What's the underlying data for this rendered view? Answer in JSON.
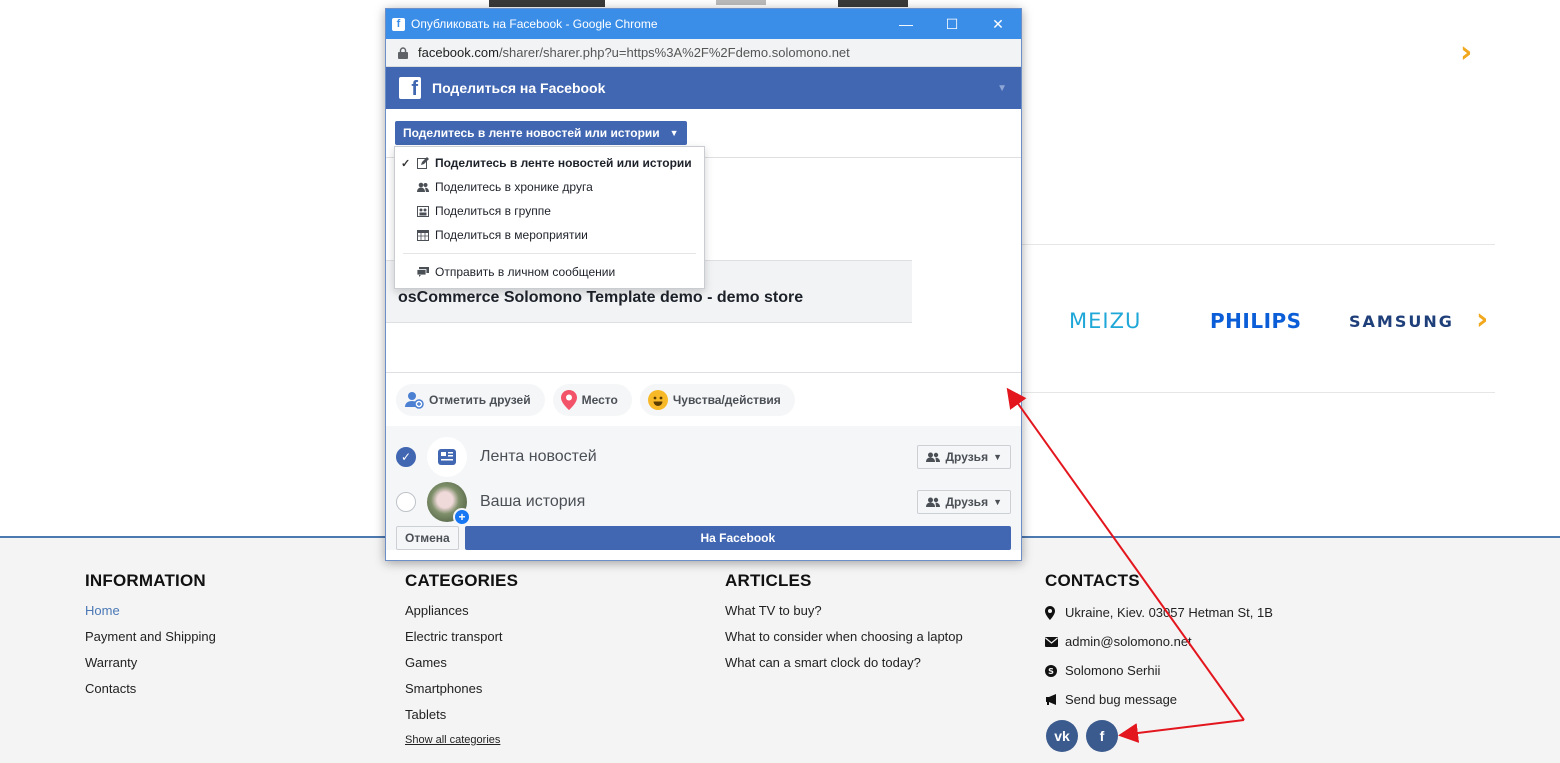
{
  "window": {
    "title": "Опубликовать на Facebook - Google Chrome",
    "controls": [
      "—",
      "☐",
      "✕"
    ],
    "url_host": "facebook.com",
    "url_path": "/sharer/sharer.php?u=https%3A%2F%2Fdemo.solomono.net"
  },
  "fb": {
    "header": "Поделиться на Facebook",
    "share_button": "Поделитесь в ленте новостей или истории",
    "menu": {
      "items": [
        {
          "label": "Поделитесь в ленте новостей или истории",
          "icon": "edit-icon",
          "selected": true
        },
        {
          "label": "Поделитесь в хронике друга",
          "icon": "friends-icon"
        },
        {
          "label": "Поделиться в группе",
          "icon": "group-icon"
        },
        {
          "label": "Поделиться в мероприятии",
          "icon": "calendar-icon"
        }
      ],
      "message_item": {
        "label": "Отправить в личном сообщении",
        "icon": "message-icon"
      }
    },
    "preview_title": "osCommerce Solomono Template demo - demo store",
    "actions": [
      {
        "label": "Отметить друзей",
        "icon": "tag-friends-icon"
      },
      {
        "label": "Место",
        "icon": "location-pin-icon"
      },
      {
        "label": "Чувства/действия",
        "icon": "smiley-icon"
      }
    ],
    "audience": [
      {
        "label": "Лента новостей",
        "privacy": "Друзья",
        "checked": true
      },
      {
        "label": "Ваша история",
        "privacy": "Друзья",
        "checked": false
      }
    ],
    "cancel_label": "Отмена",
    "post_label": "На Facebook"
  },
  "brands": [
    "MEIZU",
    "PHILIPS",
    "SAMSUNG"
  ],
  "footer": {
    "information": {
      "title": "INFORMATION",
      "links": [
        "Home",
        "Payment and Shipping",
        "Warranty",
        "Contacts"
      ]
    },
    "categories": {
      "title": "CATEGORIES",
      "links": [
        "Appliances",
        "Electric transport",
        "Games",
        "Smartphones",
        "Tablets"
      ],
      "show_all": "Show all categories"
    },
    "articles": {
      "title": "ARTICLES",
      "links": [
        "What TV to buy?",
        "What to consider when choosing a laptop",
        "What can a smart clock do today?"
      ]
    },
    "contacts": {
      "title": "CONTACTS",
      "address": "Ukraine, Kiev. 03057 Hetman St, 1B",
      "email": "admin@solomono.net",
      "skype": "Solomono Serhii",
      "bug": "Send bug message",
      "social": [
        "vk-icon",
        "facebook-icon"
      ]
    }
  },
  "colors": {
    "fb_blue": "#4267b2",
    "chrome_titlebar": "#3b8ee8",
    "accent_arrow": "#e3161e",
    "chevron": "#f2a81d",
    "footer_border": "#4d79b1"
  }
}
